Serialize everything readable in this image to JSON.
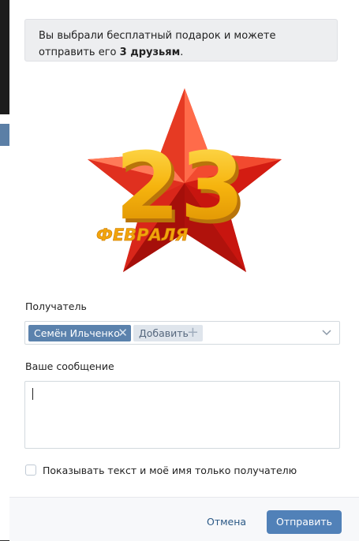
{
  "notice": {
    "text_before": "Вы выбрали бесплатный подарок и можете отправить его",
    "text_bold": "3 друзьям",
    "text_after": "."
  },
  "gift": {
    "number": "23",
    "caption": "ФЕВРАЛЯ",
    "star_color": "#e52a1f",
    "number_color": "#f4b400"
  },
  "recipient": {
    "label": "Получатель",
    "selected": "Семён Ильченко",
    "remove_icon": "close-icon",
    "add_label": "Добавить",
    "add_icon": "plus-icon"
  },
  "message": {
    "label": "Ваше сообщение",
    "value": ""
  },
  "privacy": {
    "checked": false,
    "label": "Показывать текст и моё имя только получателю"
  },
  "footer": {
    "cancel_label": "Отмена",
    "send_label": "Отправить",
    "accent": "#5181b8"
  }
}
